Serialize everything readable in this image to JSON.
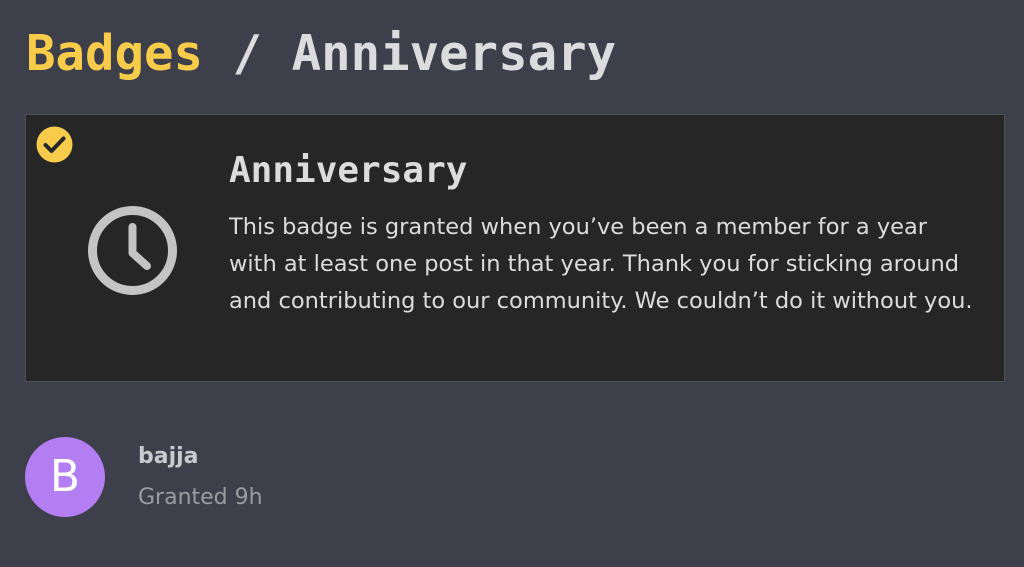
{
  "breadcrumb": {
    "parent_label": "Badges",
    "separator": "/",
    "current_label": "Anniversary"
  },
  "badge": {
    "name": "Anniversary",
    "description": "This badge is granted when you’ve been a member for a year with at least one post in that year. Thank you for sticking around and contributing to our community. We couldn’t do it without you.",
    "icon": "clock-icon",
    "granted_indicator_icon": "check-circle-icon"
  },
  "grants": [
    {
      "avatar_letter": "B",
      "username": "bajja",
      "granted_text": "Granted 9h"
    }
  ],
  "colors": {
    "page_background": "#3d404a",
    "card_background": "#262626",
    "accent": "#f8cc4a",
    "avatar": "#b47ef3",
    "text": "#dcdcdc",
    "muted_text": "#9a9ca1"
  }
}
